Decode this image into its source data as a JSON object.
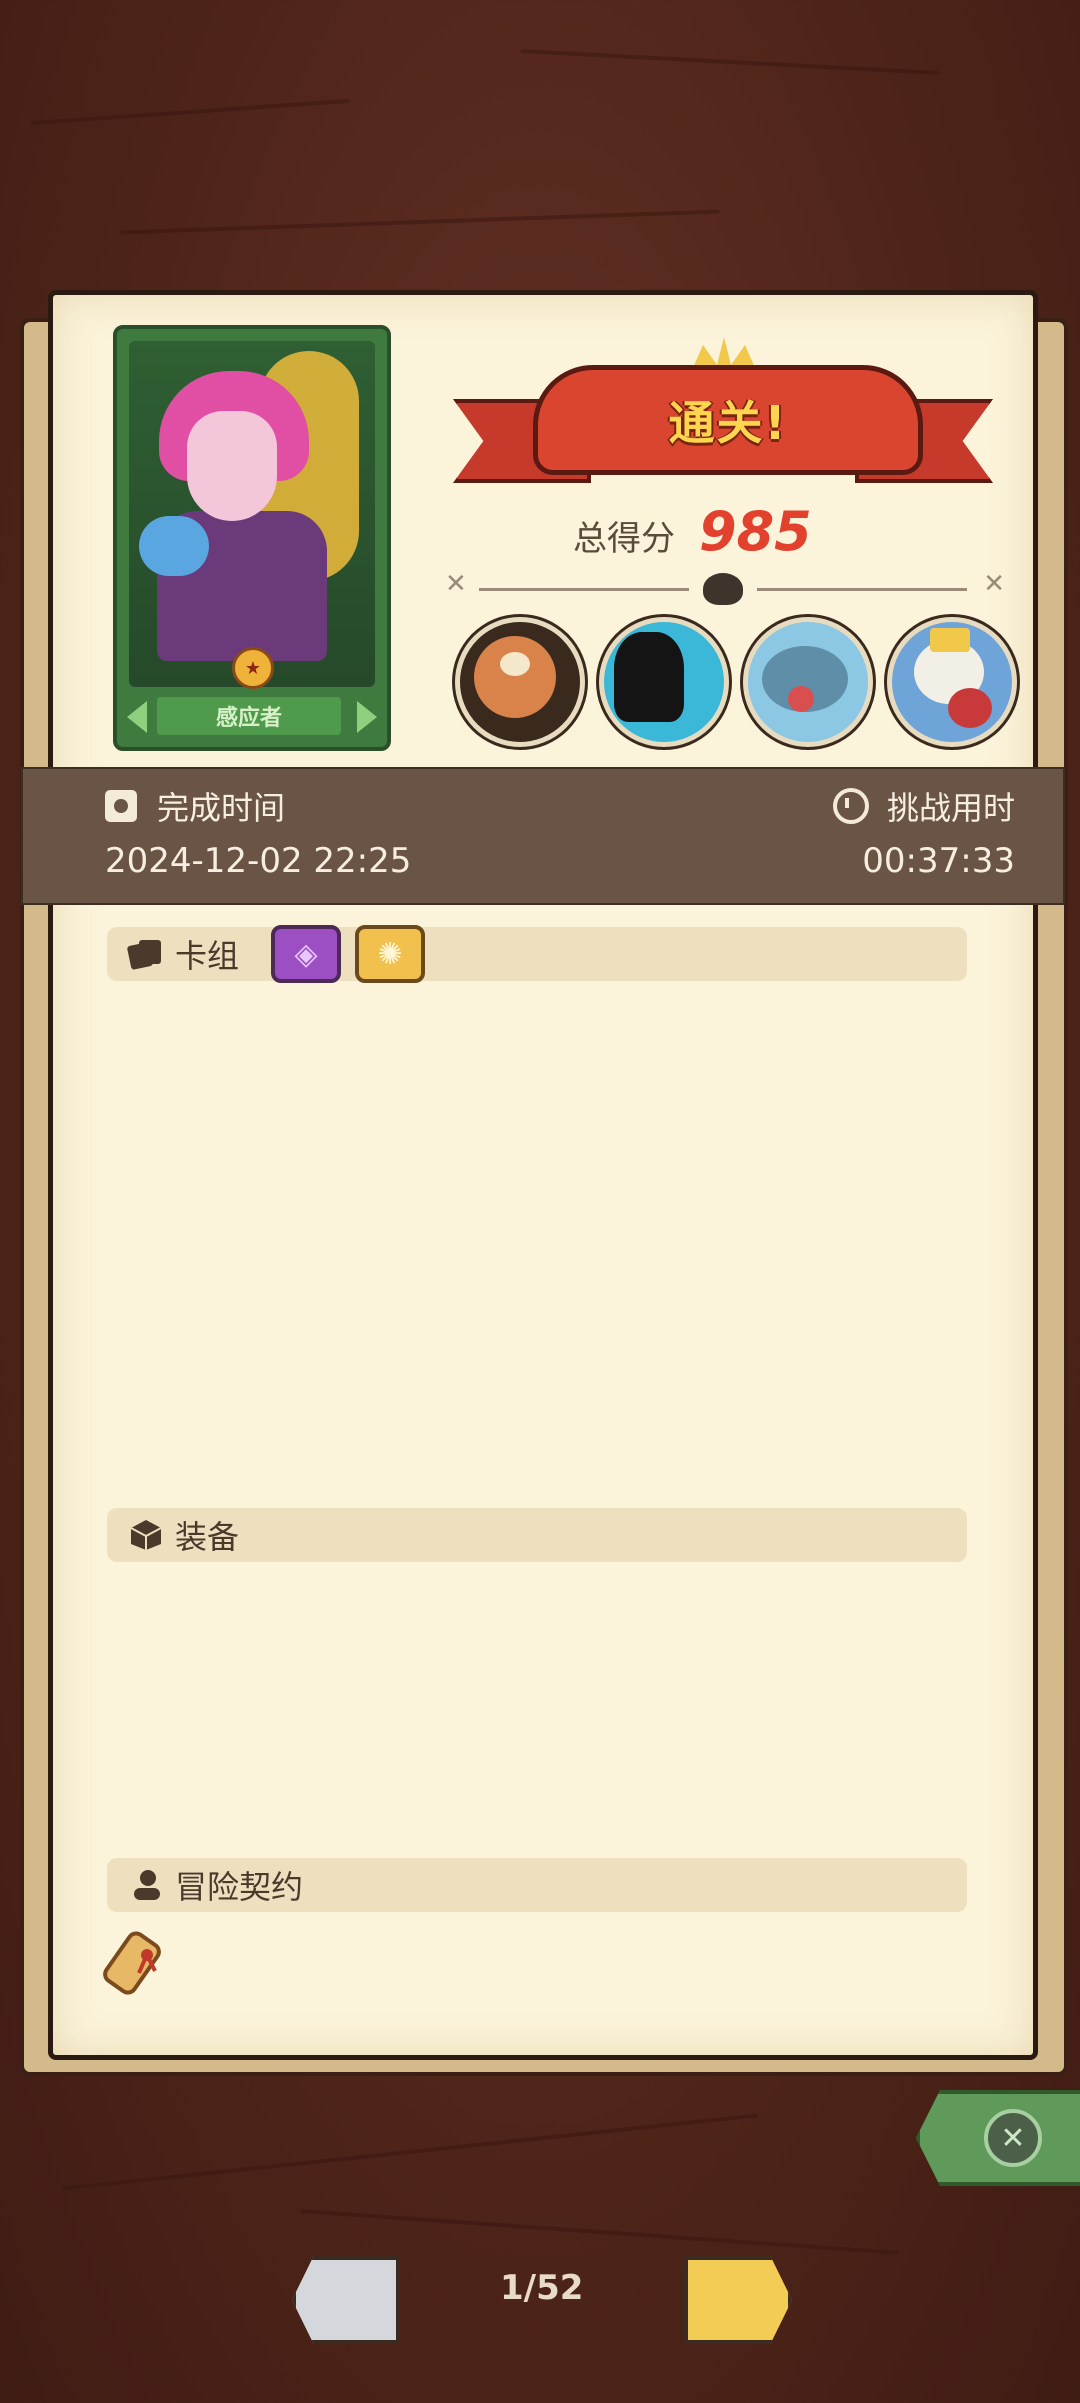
{
  "hero": {
    "class_name": "感应者"
  },
  "result": {
    "banner": "通关!",
    "score_label": "总得分",
    "score_value": "985"
  },
  "bosses": [
    "cyclops-boss",
    "shadow-boss",
    "fish-boss",
    "skull-king-boss"
  ],
  "stats": {
    "finish_time_label": "完成时间",
    "finish_time_value": "2024-12-02 22:25",
    "duration_label": "挑战用时",
    "duration_value": "00:37:33"
  },
  "sections": {
    "deck_label": "卡组",
    "equipment_label": "装备",
    "contract_label": "冒险契约"
  },
  "deck_icons": [
    "eye-sigil-icon",
    "sun-spiral-icon"
  ],
  "pager": {
    "text": "1/52"
  },
  "colors": {
    "accent_red": "#e2412e",
    "banner_red": "#d9452f",
    "banner_text": "#ffd550",
    "paper": "#fbf3da"
  }
}
